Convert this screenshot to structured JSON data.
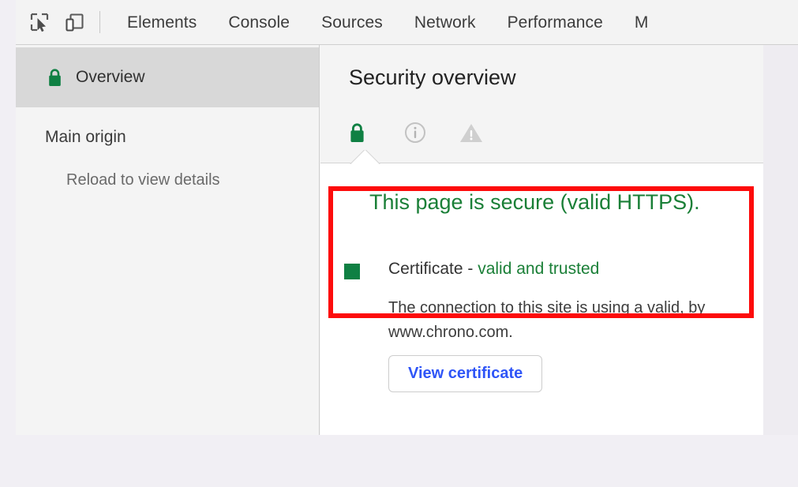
{
  "toolbar": {
    "inspect_icon": "inspect-element-icon",
    "device_icon": "device-toolbar-icon",
    "tabs": [
      {
        "label": "Elements",
        "selected": false
      },
      {
        "label": "Console",
        "selected": false
      },
      {
        "label": "Sources",
        "selected": false
      },
      {
        "label": "Network",
        "selected": false
      },
      {
        "label": "Performance",
        "selected": false
      },
      {
        "label": "M",
        "selected": false
      }
    ]
  },
  "sidebar": {
    "overview": {
      "label": "Overview",
      "icon": "lock-icon",
      "selected": true
    },
    "origin_group_header": "Main origin",
    "origin_items": [
      {
        "label": "Reload to view details"
      }
    ]
  },
  "main": {
    "title": "Security overview",
    "status_icons": [
      {
        "name": "lock-icon",
        "state": "secure"
      },
      {
        "name": "info-circle-icon",
        "state": "neutral"
      },
      {
        "name": "warning-triangle-icon",
        "state": "neutral"
      }
    ],
    "headline": "This page is secure (valid HTTPS).",
    "certificate": {
      "bullet_icon": "square-bullet-icon",
      "label": "Certificate - ",
      "status": "valid and trusted",
      "description": "The connection to this site is using a valid, by www.chrono.com.",
      "button_label": "View certificate"
    }
  },
  "annotation": {
    "type": "highlight-rectangle",
    "color": "#fd0b0b"
  },
  "colors": {
    "secure_green": "#1a7f37",
    "bullet_green": "#0f8043",
    "link_blue": "#2f55f7",
    "annotation_red": "#fd0b0b",
    "toolbar_bg": "#f3f3f3",
    "selected_row_bg": "#d8d8d8"
  }
}
